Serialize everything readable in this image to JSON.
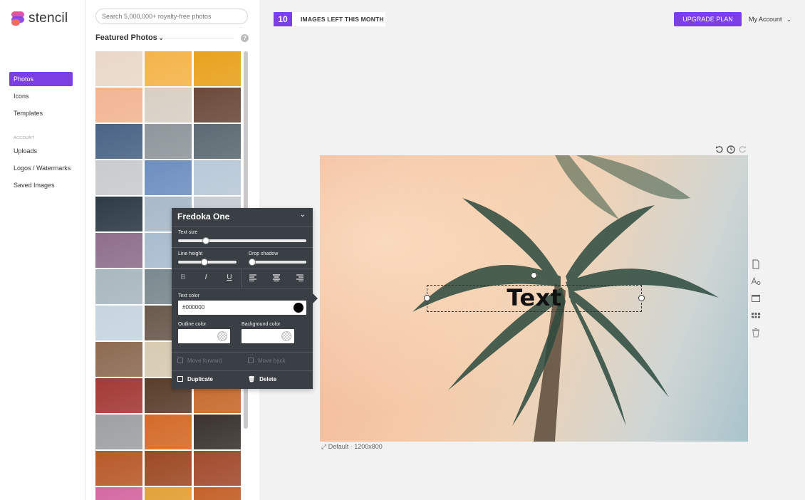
{
  "app": {
    "name": "stencil"
  },
  "nav": {
    "items": [
      {
        "label": "Photos",
        "active": true
      },
      {
        "label": "Icons",
        "active": false
      },
      {
        "label": "Templates",
        "active": false
      }
    ],
    "section_label": "ACCOUNT",
    "account_items": [
      {
        "label": "Uploads"
      },
      {
        "label": "Logos / Watermarks"
      },
      {
        "label": "Saved Images"
      }
    ]
  },
  "panel": {
    "search_placeholder": "Search 5,000,000+ royalty-free photos",
    "featured_label": "Featured Photos",
    "help_label": "?",
    "thumb_colors": [
      [
        "#e9d8c7",
        "#f4b44a",
        "#e8a21e"
      ],
      [
        "#f1b593",
        "#d8cfc4",
        "#6b4a3b"
      ],
      [
        "#4a6486",
        "#8f979c",
        "#5d6a73"
      ],
      [
        "#c9ccce",
        "#6d8fc0",
        "#b9c9d8"
      ],
      [
        "#2e3b45",
        "#a9b9c9",
        "#c6ccd2"
      ],
      [
        "#8e6f8c",
        "#a9bdd0",
        "#d6dde2"
      ],
      [
        "#aab7bf",
        "#7b8a90",
        "#dfe2e3"
      ],
      [
        "#c7d5df",
        "#6b5a4e",
        "#b0a294"
      ],
      [
        "#8d6b52",
        "#d8cbb2",
        "#d9c4a8"
      ],
      [
        "#a33a36",
        "#5a3e2c",
        "#c66a2c"
      ],
      [
        "#9da1a2",
        "#d36b2a",
        "#3a3330"
      ],
      [
        "#b85a2a",
        "#9d4a24",
        "#a24b2e"
      ],
      [
        "#d46aa2",
        "#e2a23a",
        "#c4632b"
      ]
    ]
  },
  "topbar": {
    "images_left": "10",
    "images_left_label": "IMAGES LEFT THIS MONTH",
    "upgrade_label": "UPGRADE PLAN",
    "account_label": "My Account"
  },
  "canvas": {
    "text": "Text",
    "size_label": "Default · 1200x800"
  },
  "text_panel": {
    "font": "Fredoka One",
    "text_size_label": "Text size",
    "text_size_value": 0.2,
    "line_height_label": "Line height",
    "line_height_value": 0.45,
    "drop_shadow_label": "Drop shadow",
    "drop_shadow_value": 0.0,
    "bold_glyph": "B",
    "italic_glyph": "I",
    "underline_glyph": "U",
    "text_color_label": "Text color",
    "text_color_value": "#000000",
    "outline_color_label": "Outline color",
    "background_color_label": "Background color",
    "move_forward_label": "Move forward",
    "move_back_label": "Move back",
    "duplicate_label": "Duplicate",
    "delete_label": "Delete"
  },
  "colors": {
    "accent": "#7b3fe4",
    "panel_bg": "#3a3f45"
  }
}
